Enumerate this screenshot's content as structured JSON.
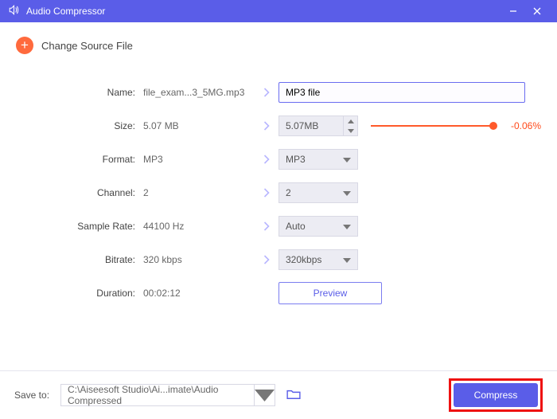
{
  "window": {
    "title": "Audio Compressor"
  },
  "source": {
    "label": "Change Source File"
  },
  "rows": {
    "name": {
      "label": "Name:",
      "value": "file_exam...3_5MG.mp3",
      "input": "MP3 file"
    },
    "size": {
      "label": "Size:",
      "value": "5.07 MB",
      "input": "5.07MB",
      "delta": "-0.06%"
    },
    "format": {
      "label": "Format:",
      "value": "MP3",
      "input": "MP3"
    },
    "channel": {
      "label": "Channel:",
      "value": "2",
      "input": "2"
    },
    "samplerate": {
      "label": "Sample Rate:",
      "value": "44100 Hz",
      "input": "Auto"
    },
    "bitrate": {
      "label": "Bitrate:",
      "value": "320 kbps",
      "input": "320kbps"
    },
    "duration": {
      "label": "Duration:",
      "value": "00:02:12",
      "preview": "Preview"
    }
  },
  "footer": {
    "saveto": "Save to:",
    "path": "C:\\Aiseesoft Studio\\Ai...imate\\Audio Compressed",
    "compress": "Compress"
  }
}
